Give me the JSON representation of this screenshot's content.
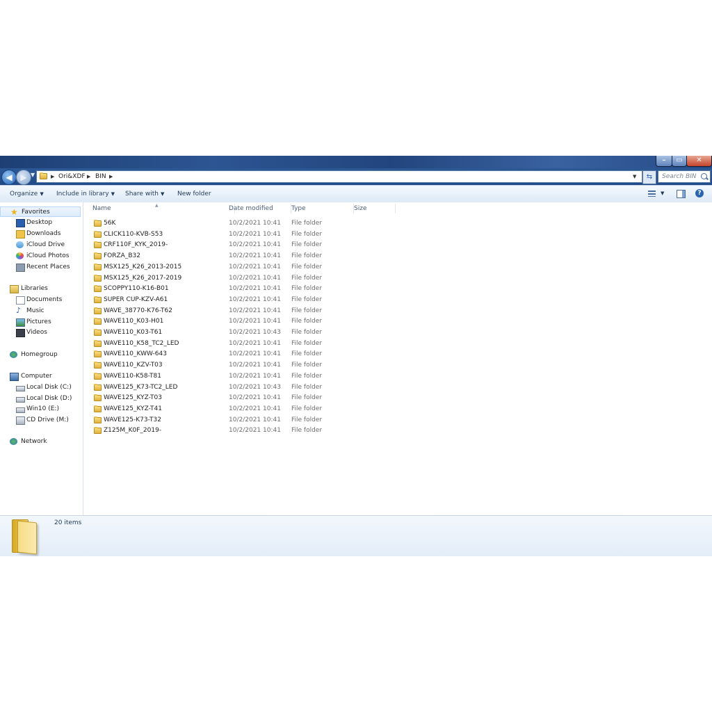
{
  "window": {
    "caption_buttons": {
      "minimize": "–",
      "maximize": "▭",
      "close": "✕"
    }
  },
  "address": {
    "crumbs": [
      "Ori&XDF",
      "BIN"
    ],
    "search_placeholder": "Search BIN"
  },
  "commands": {
    "organize": "Organize",
    "include_in_library": "Include in library",
    "share_with": "Share with",
    "new_folder": "New folder"
  },
  "nav": {
    "favorites": "Favorites",
    "desktop": "Desktop",
    "downloads": "Downloads",
    "icloud_drive": "iCloud Drive",
    "icloud_photos": "iCloud Photos",
    "recent_places": "Recent Places",
    "libraries": "Libraries",
    "documents": "Documents",
    "music": "Music",
    "pictures": "Pictures",
    "videos": "Videos",
    "homegroup": "Homegroup",
    "computer": "Computer",
    "local_disk_c": "Local Disk (C:)",
    "local_disk_d": "Local Disk (D:)",
    "win10_e": "Win10 (E:)",
    "cd_drive_m": "CD Drive (M:)",
    "network": "Network"
  },
  "columns": {
    "name": "Name",
    "date_modified": "Date modified",
    "type": "Type",
    "size": "Size"
  },
  "files": [
    {
      "name": "56K",
      "date": "10/2/2021 10:41",
      "type": "File folder"
    },
    {
      "name": "CLICK110-KVB-S53",
      "date": "10/2/2021 10:41",
      "type": "File folder"
    },
    {
      "name": "CRF110F_KYK_2019-",
      "date": "10/2/2021 10:41",
      "type": "File folder"
    },
    {
      "name": "FORZA_B32",
      "date": "10/2/2021 10:41",
      "type": "File folder"
    },
    {
      "name": "MSX125_K26_2013-2015",
      "date": "10/2/2021 10:41",
      "type": "File folder"
    },
    {
      "name": "MSX125_K26_2017-2019",
      "date": "10/2/2021 10:41",
      "type": "File folder"
    },
    {
      "name": "SCOPPY110-K16-B01",
      "date": "10/2/2021 10:41",
      "type": "File folder"
    },
    {
      "name": "SUPER CUP-KZV-A61",
      "date": "10/2/2021 10:41",
      "type": "File folder"
    },
    {
      "name": "WAVE_38770-K76-T62",
      "date": "10/2/2021 10:41",
      "type": "File folder"
    },
    {
      "name": "WAVE110_K03-H01",
      "date": "10/2/2021 10:41",
      "type": "File folder"
    },
    {
      "name": "WAVE110_K03-T61",
      "date": "10/2/2021 10:43",
      "type": "File folder"
    },
    {
      "name": "WAVE110_K58_TC2_LED",
      "date": "10/2/2021 10:41",
      "type": "File folder"
    },
    {
      "name": "WAVE110_KWW-643",
      "date": "10/2/2021 10:41",
      "type": "File folder"
    },
    {
      "name": "WAVE110_KZV-T03",
      "date": "10/2/2021 10:41",
      "type": "File folder"
    },
    {
      "name": "WAVE110-K58-T81",
      "date": "10/2/2021 10:41",
      "type": "File folder"
    },
    {
      "name": "WAVE125_K73-TC2_LED",
      "date": "10/2/2021 10:43",
      "type": "File folder"
    },
    {
      "name": "WAVE125_KYZ-T03",
      "date": "10/2/2021 10:41",
      "type": "File folder"
    },
    {
      "name": "WAVE125_KYZ-T41",
      "date": "10/2/2021 10:41",
      "type": "File folder"
    },
    {
      "name": "WAVE125-K73-T32",
      "date": "10/2/2021 10:41",
      "type": "File folder"
    },
    {
      "name": "Z125M_K0F_2019-",
      "date": "10/2/2021 10:41",
      "type": "File folder"
    }
  ],
  "status": {
    "item_count": "20 items"
  },
  "icons": {
    "back": "back-arrow-icon",
    "forward": "forward-arrow-icon",
    "refresh": "refresh-icon",
    "search": "search-icon",
    "views": "views-icon",
    "preview": "preview-pane-icon",
    "help": "help-icon",
    "folder": "folder-icon"
  },
  "colors": {
    "titlebar": "#1d3f74",
    "accent": "#2a64b0",
    "folder": "#f2d26a"
  }
}
